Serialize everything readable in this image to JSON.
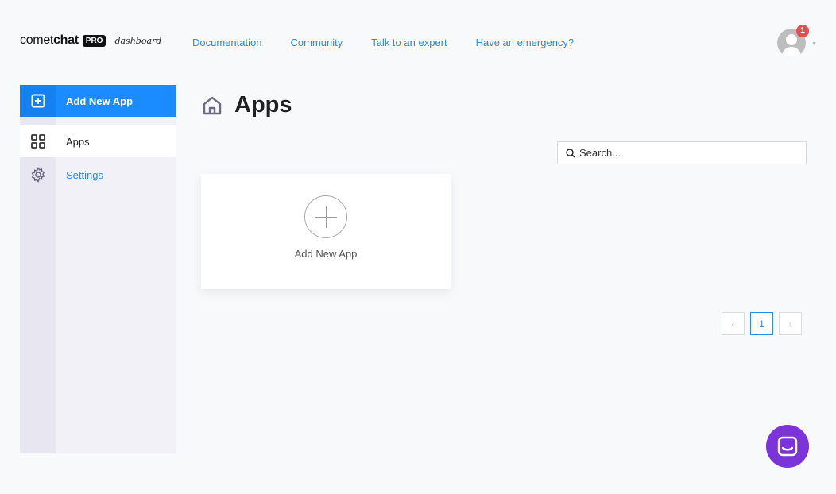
{
  "brand": {
    "name_light": "comet",
    "name_bold": "chat",
    "tag": "PRO",
    "sub": "dashboard"
  },
  "nav": [
    "Documentation",
    "Community",
    "Talk to an expert",
    "Have an emergency?"
  ],
  "user": {
    "notifications": "1"
  },
  "sidebar": {
    "add_label": "Add New App",
    "items": [
      {
        "label": "Apps",
        "icon": "grid-icon",
        "active": true
      },
      {
        "label": "Settings",
        "icon": "gear-icon"
      }
    ]
  },
  "main": {
    "title": "Apps",
    "search_placeholder": "Search...",
    "add_card_label": "Add New App"
  },
  "pagination": {
    "prev": "‹",
    "current": "1",
    "next": "›"
  },
  "colors": {
    "accent": "#1a8cff",
    "link": "#2f8ae2",
    "chat": "#7a34d8",
    "badge": "#e84b4b"
  }
}
